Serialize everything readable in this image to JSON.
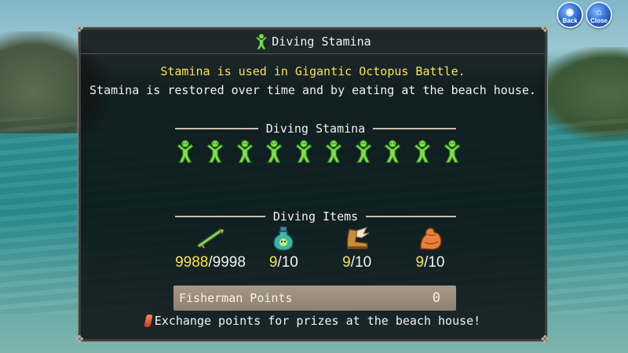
{
  "top_buttons": {
    "back_label": "Back",
    "close_label": "Close"
  },
  "dialog": {
    "title": "Diving Stamina",
    "message_highlight": "Stamina is used in Gigantic Octopus Battle.",
    "message": "Stamina is restored over time and by eating at the beach house.",
    "stamina_section_label": "Diving Stamina",
    "stamina_icon": "stamina-figure-icon",
    "stamina_current": 10,
    "stamina_max": 10,
    "items_section_label": "Diving Items",
    "items": [
      {
        "icon": "harpoon-icon",
        "current": "9988",
        "separator": "/",
        "max": "9998"
      },
      {
        "icon": "potion-bottle-icon",
        "current": "9",
        "separator": "/",
        "max": "10"
      },
      {
        "icon": "boot-icon",
        "current": "9",
        "separator": "/",
        "max": "10"
      },
      {
        "icon": "muscle-arm-icon",
        "current": "9",
        "separator": "/",
        "max": "10"
      }
    ],
    "points_label": "Fisherman Points",
    "points_value": "0",
    "footer_text": "Exchange points for prizes at the beach house!"
  },
  "colors": {
    "highlight": "#f7e44a",
    "stamina_green": "#7ee04a",
    "points_bar": "#a79988"
  }
}
